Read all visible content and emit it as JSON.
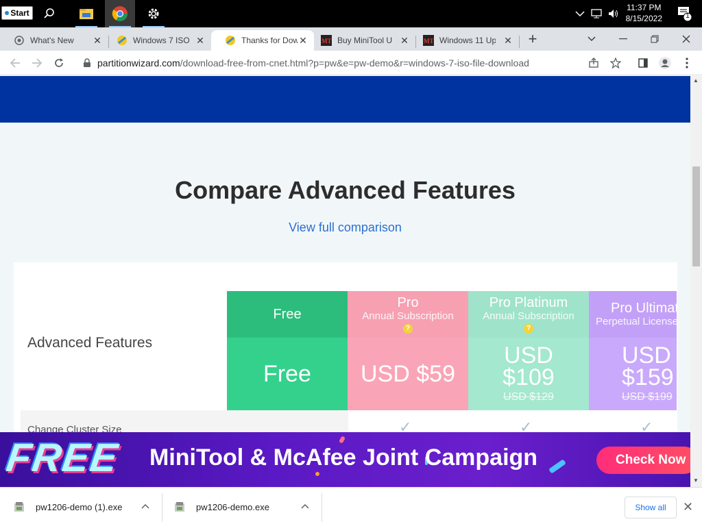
{
  "taskbar": {
    "start_label": "Start",
    "time": "11:37 PM",
    "date": "8/15/2022",
    "notification_count": "1"
  },
  "tabs": [
    {
      "title": "What's New"
    },
    {
      "title": "Windows 7 ISO"
    },
    {
      "title": "Thanks for Dow"
    },
    {
      "title": "Buy MiniTool U"
    },
    {
      "title": "Windows 11 Up"
    }
  ],
  "address": {
    "host": "partitionwizard.com",
    "path": "/download-free-from-cnet.html?p=pw&e=pw-demo&r=windows-7-iso-file-download"
  },
  "page": {
    "title": "Compare Advanced Features",
    "comparison_link": "View full comparison",
    "advanced_label": "Advanced Features",
    "row_label": "Change Cluster Size",
    "plans": [
      {
        "name": "Free",
        "subtitle": "",
        "price": "Free",
        "old_price": "",
        "color": "#34d18d",
        "header_color": "#2cbd7c"
      },
      {
        "name": "Pro",
        "subtitle": "Annual Subscription",
        "price": "USD $59",
        "old_price": "",
        "color": "#f9a5b7",
        "header_color": "#f7a0b2"
      },
      {
        "name": "Pro Platinum",
        "subtitle": "Annual Subscription",
        "price": "USD $109",
        "old_price": "USD $129",
        "color": "#a3e8cf",
        "header_color": "#9fe3ca"
      },
      {
        "name": "Pro Ultimate",
        "subtitle": "Perpetual License",
        "price": "USD $159",
        "old_price": "USD $199",
        "color": "#c9a9fb",
        "header_color": "#c2a0f7"
      }
    ]
  },
  "banner": {
    "free_text": "FREE",
    "title": "MiniTool & McAfee Joint Campaign",
    "cta": "Check Now"
  },
  "downloads": {
    "items": [
      {
        "file": "pw1206-demo (1).exe"
      },
      {
        "file": "pw1206-demo.exe"
      }
    ],
    "show_all": "Show all"
  }
}
